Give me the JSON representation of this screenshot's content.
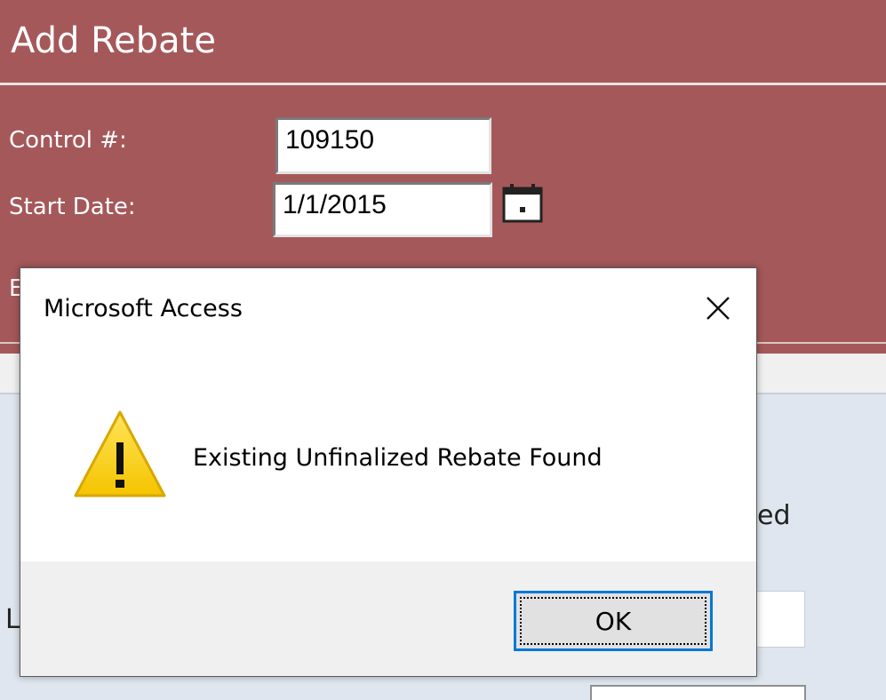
{
  "form": {
    "title": "Add Rebate",
    "control_label": "Control #:",
    "control_value": "109150",
    "start_date_label": "Start Date:",
    "start_date_value": "1/1/2015",
    "hidden_label_fragment": "E",
    "partial_right_text": "ed",
    "partial_left_text": "L",
    "header_color": "#a5585a"
  },
  "dialog": {
    "title": "Microsoft Access",
    "message": "Existing Unfinalized Rebate Found",
    "ok_label": "OK",
    "icons": {
      "warning": "warning-triangle-icon",
      "close": "close-icon"
    },
    "accent_color": "#0078d7",
    "warning_color": "#f8d010"
  }
}
